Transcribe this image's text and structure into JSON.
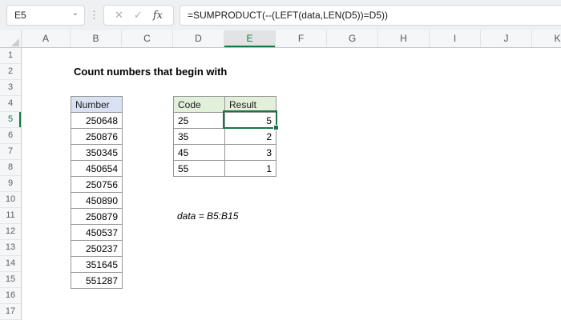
{
  "formula_bar": {
    "cell_reference": "E5",
    "chevron_glyph": "⌄",
    "dots_glyph": "⋮",
    "cancel_glyph": "✕",
    "enter_glyph": "✓",
    "fx_label": "fx",
    "formula": "=SUMPRODUCT(--(LEFT(data,LEN(D5))=D5))"
  },
  "grid": {
    "column_headers": [
      "A",
      "B",
      "C",
      "D",
      "E",
      "F",
      "G",
      "H",
      "I",
      "J",
      "K"
    ],
    "row_headers": [
      "1",
      "2",
      "3",
      "4",
      "5",
      "6",
      "7",
      "8",
      "9",
      "10",
      "11",
      "12",
      "13",
      "14",
      "15",
      "16",
      "17"
    ],
    "selected_column": "E",
    "selected_row": "5",
    "active_cell": "E5"
  },
  "content": {
    "title": "Count numbers that begin with",
    "note": "data = B5:B15",
    "number_table": {
      "header": "Number",
      "values": [
        "250648",
        "250876",
        "350345",
        "450654",
        "250756",
        "450890",
        "250879",
        "450537",
        "250237",
        "351645",
        "551287"
      ]
    },
    "code_table": {
      "code_header": "Code",
      "result_header": "Result",
      "rows": [
        {
          "code": "25",
          "result": "5"
        },
        {
          "code": "35",
          "result": "2"
        },
        {
          "code": "45",
          "result": "3"
        },
        {
          "code": "55",
          "result": "1"
        }
      ]
    }
  },
  "colors": {
    "accent_green": "#107C41",
    "selection_border": "#1F7246",
    "number_header_fill": "#D9E1F2",
    "code_header_fill": "#E2EFDA",
    "table_border": "#979797"
  }
}
